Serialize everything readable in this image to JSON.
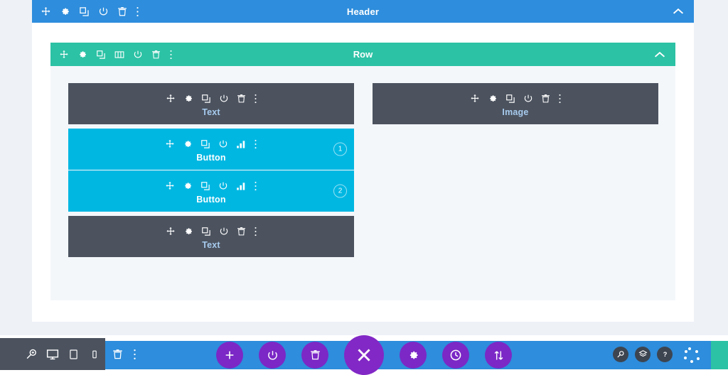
{
  "section": {
    "title": "Header",
    "collapse_icon": "chevron-up-icon",
    "bg_color": "#2e8ddc",
    "tools": [
      {
        "name": "move-icon",
        "title": "Move Section"
      },
      {
        "name": "gear-icon",
        "title": "Section Settings"
      },
      {
        "name": "duplicate-icon",
        "title": "Duplicate Section"
      },
      {
        "name": "power-icon",
        "title": "Disable Section"
      },
      {
        "name": "trash-icon",
        "title": "Delete Section"
      },
      {
        "name": "more-options-icon",
        "title": "More Options"
      }
    ]
  },
  "row": {
    "title": "Row",
    "collapse_icon": "chevron-up-icon",
    "bg_color": "#2cc2a5",
    "tools": [
      {
        "name": "move-icon",
        "title": "Move Row"
      },
      {
        "name": "gear-icon",
        "title": "Row Settings"
      },
      {
        "name": "duplicate-icon",
        "title": "Duplicate Row"
      },
      {
        "name": "columns-icon",
        "title": "Column Structure"
      },
      {
        "name": "power-icon",
        "title": "Disable Row"
      },
      {
        "name": "trash-icon",
        "title": "Delete Row"
      },
      {
        "name": "more-options-icon",
        "title": "More Options"
      }
    ]
  },
  "columns": [
    {
      "modules": [
        {
          "label": "Text",
          "type": "text",
          "color": "#4c535f",
          "badge": null,
          "tools": [
            "move-icon",
            "gear-icon",
            "duplicate-icon",
            "power-icon",
            "trash-icon",
            "more-options-icon"
          ]
        },
        {
          "label": "Button",
          "type": "button",
          "color": "#00b7e2",
          "badge": "1",
          "tools": [
            "move-icon",
            "gear-icon",
            "duplicate-icon",
            "power-icon",
            "stats-icon",
            "more-options-icon"
          ]
        },
        {
          "label": "Button",
          "type": "button",
          "color": "#00b7e2",
          "badge": "2",
          "tools": [
            "move-icon",
            "gear-icon",
            "duplicate-icon",
            "power-icon",
            "stats-icon",
            "more-options-icon"
          ]
        },
        {
          "label": "Text",
          "type": "text",
          "color": "#4c535f",
          "badge": null,
          "tools": [
            "move-icon",
            "gear-icon",
            "duplicate-icon",
            "power-icon",
            "trash-icon",
            "more-options-icon"
          ]
        }
      ]
    },
    {
      "modules": [
        {
          "label": "Image",
          "type": "image",
          "color": "#4c535f",
          "badge": null,
          "tools": [
            "move-icon",
            "gear-icon",
            "duplicate-icon",
            "power-icon",
            "trash-icon",
            "more-options-icon"
          ]
        }
      ]
    }
  ],
  "bottom_bar": {
    "bg_color": "#2e8ddc",
    "left_panel": [
      {
        "name": "zoom-icon",
        "title": "Zoom"
      },
      {
        "name": "desktop-icon",
        "title": "Desktop View"
      },
      {
        "name": "tablet-icon",
        "title": "Tablet View"
      },
      {
        "name": "phone-icon",
        "title": "Phone View"
      }
    ],
    "left_blue": [
      {
        "name": "trash-icon",
        "title": "Empty Trash"
      },
      {
        "name": "more-options-icon",
        "title": "More Options"
      }
    ],
    "center_buttons": [
      {
        "name": "add-icon",
        "title": "Add Section",
        "size": "small"
      },
      {
        "name": "power-icon",
        "title": "Disable Builder",
        "size": "small"
      },
      {
        "name": "trash-icon",
        "title": "Clear Layout",
        "size": "small"
      },
      {
        "name": "close-icon",
        "title": "Close Builder",
        "size": "big"
      },
      {
        "name": "gear-icon",
        "title": "Settings",
        "size": "small"
      },
      {
        "name": "history-icon",
        "title": "Editing History",
        "size": "small"
      },
      {
        "name": "portability-icon",
        "title": "Portability",
        "size": "small"
      }
    ],
    "right_buttons": [
      {
        "name": "search-icon",
        "title": "Search"
      },
      {
        "name": "layers-icon",
        "title": "Layers View"
      },
      {
        "name": "help-icon",
        "title": "Help"
      }
    ],
    "grip": {
      "name": "drag-handle-icon",
      "title": "Drag Toolbar"
    },
    "accent_color": "#2cc2a5"
  }
}
